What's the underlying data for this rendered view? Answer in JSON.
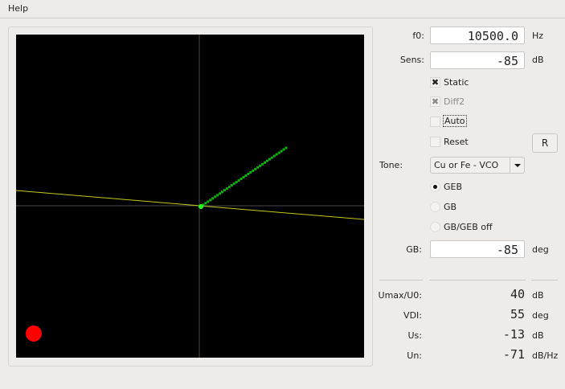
{
  "menu": {
    "help": "Help"
  },
  "plot": {
    "background": "#000000",
    "crosshair_color": "#4a4a4a",
    "line_color": "#c8c820",
    "dots_color": "#11b011",
    "indicator_color": "#ff0000"
  },
  "controls": {
    "f0": {
      "label": "f0:",
      "value": "10500.0",
      "unit": "Hz"
    },
    "sens": {
      "label": "Sens:",
      "value": "-85",
      "unit": "dB"
    },
    "static": {
      "label": "Static",
      "checked": true
    },
    "diff2": {
      "label": "Diff2",
      "checked": true,
      "disabled": true
    },
    "auto": {
      "label": "Auto",
      "checked": false
    },
    "reset": {
      "label": "Reset",
      "checked": false
    },
    "r_button": "R",
    "tone": {
      "label": "Tone:",
      "value": "Cu or Fe - VCO"
    },
    "radios": [
      {
        "label": "GEB",
        "selected": true
      },
      {
        "label": "GB",
        "selected": false
      },
      {
        "label": "GB/GEB off",
        "selected": false
      }
    ],
    "gb": {
      "label": "GB:",
      "value": "-85",
      "unit": "deg"
    }
  },
  "readouts": [
    {
      "label": "Umax/U0:",
      "value": "40",
      "unit": "dB"
    },
    {
      "label": "VDI:",
      "value": "55",
      "unit": "deg"
    },
    {
      "label": "Us:",
      "value": "-13",
      "unit": "dB"
    },
    {
      "label": "Un:",
      "value": "-71",
      "unit": "dB/Hz"
    }
  ]
}
